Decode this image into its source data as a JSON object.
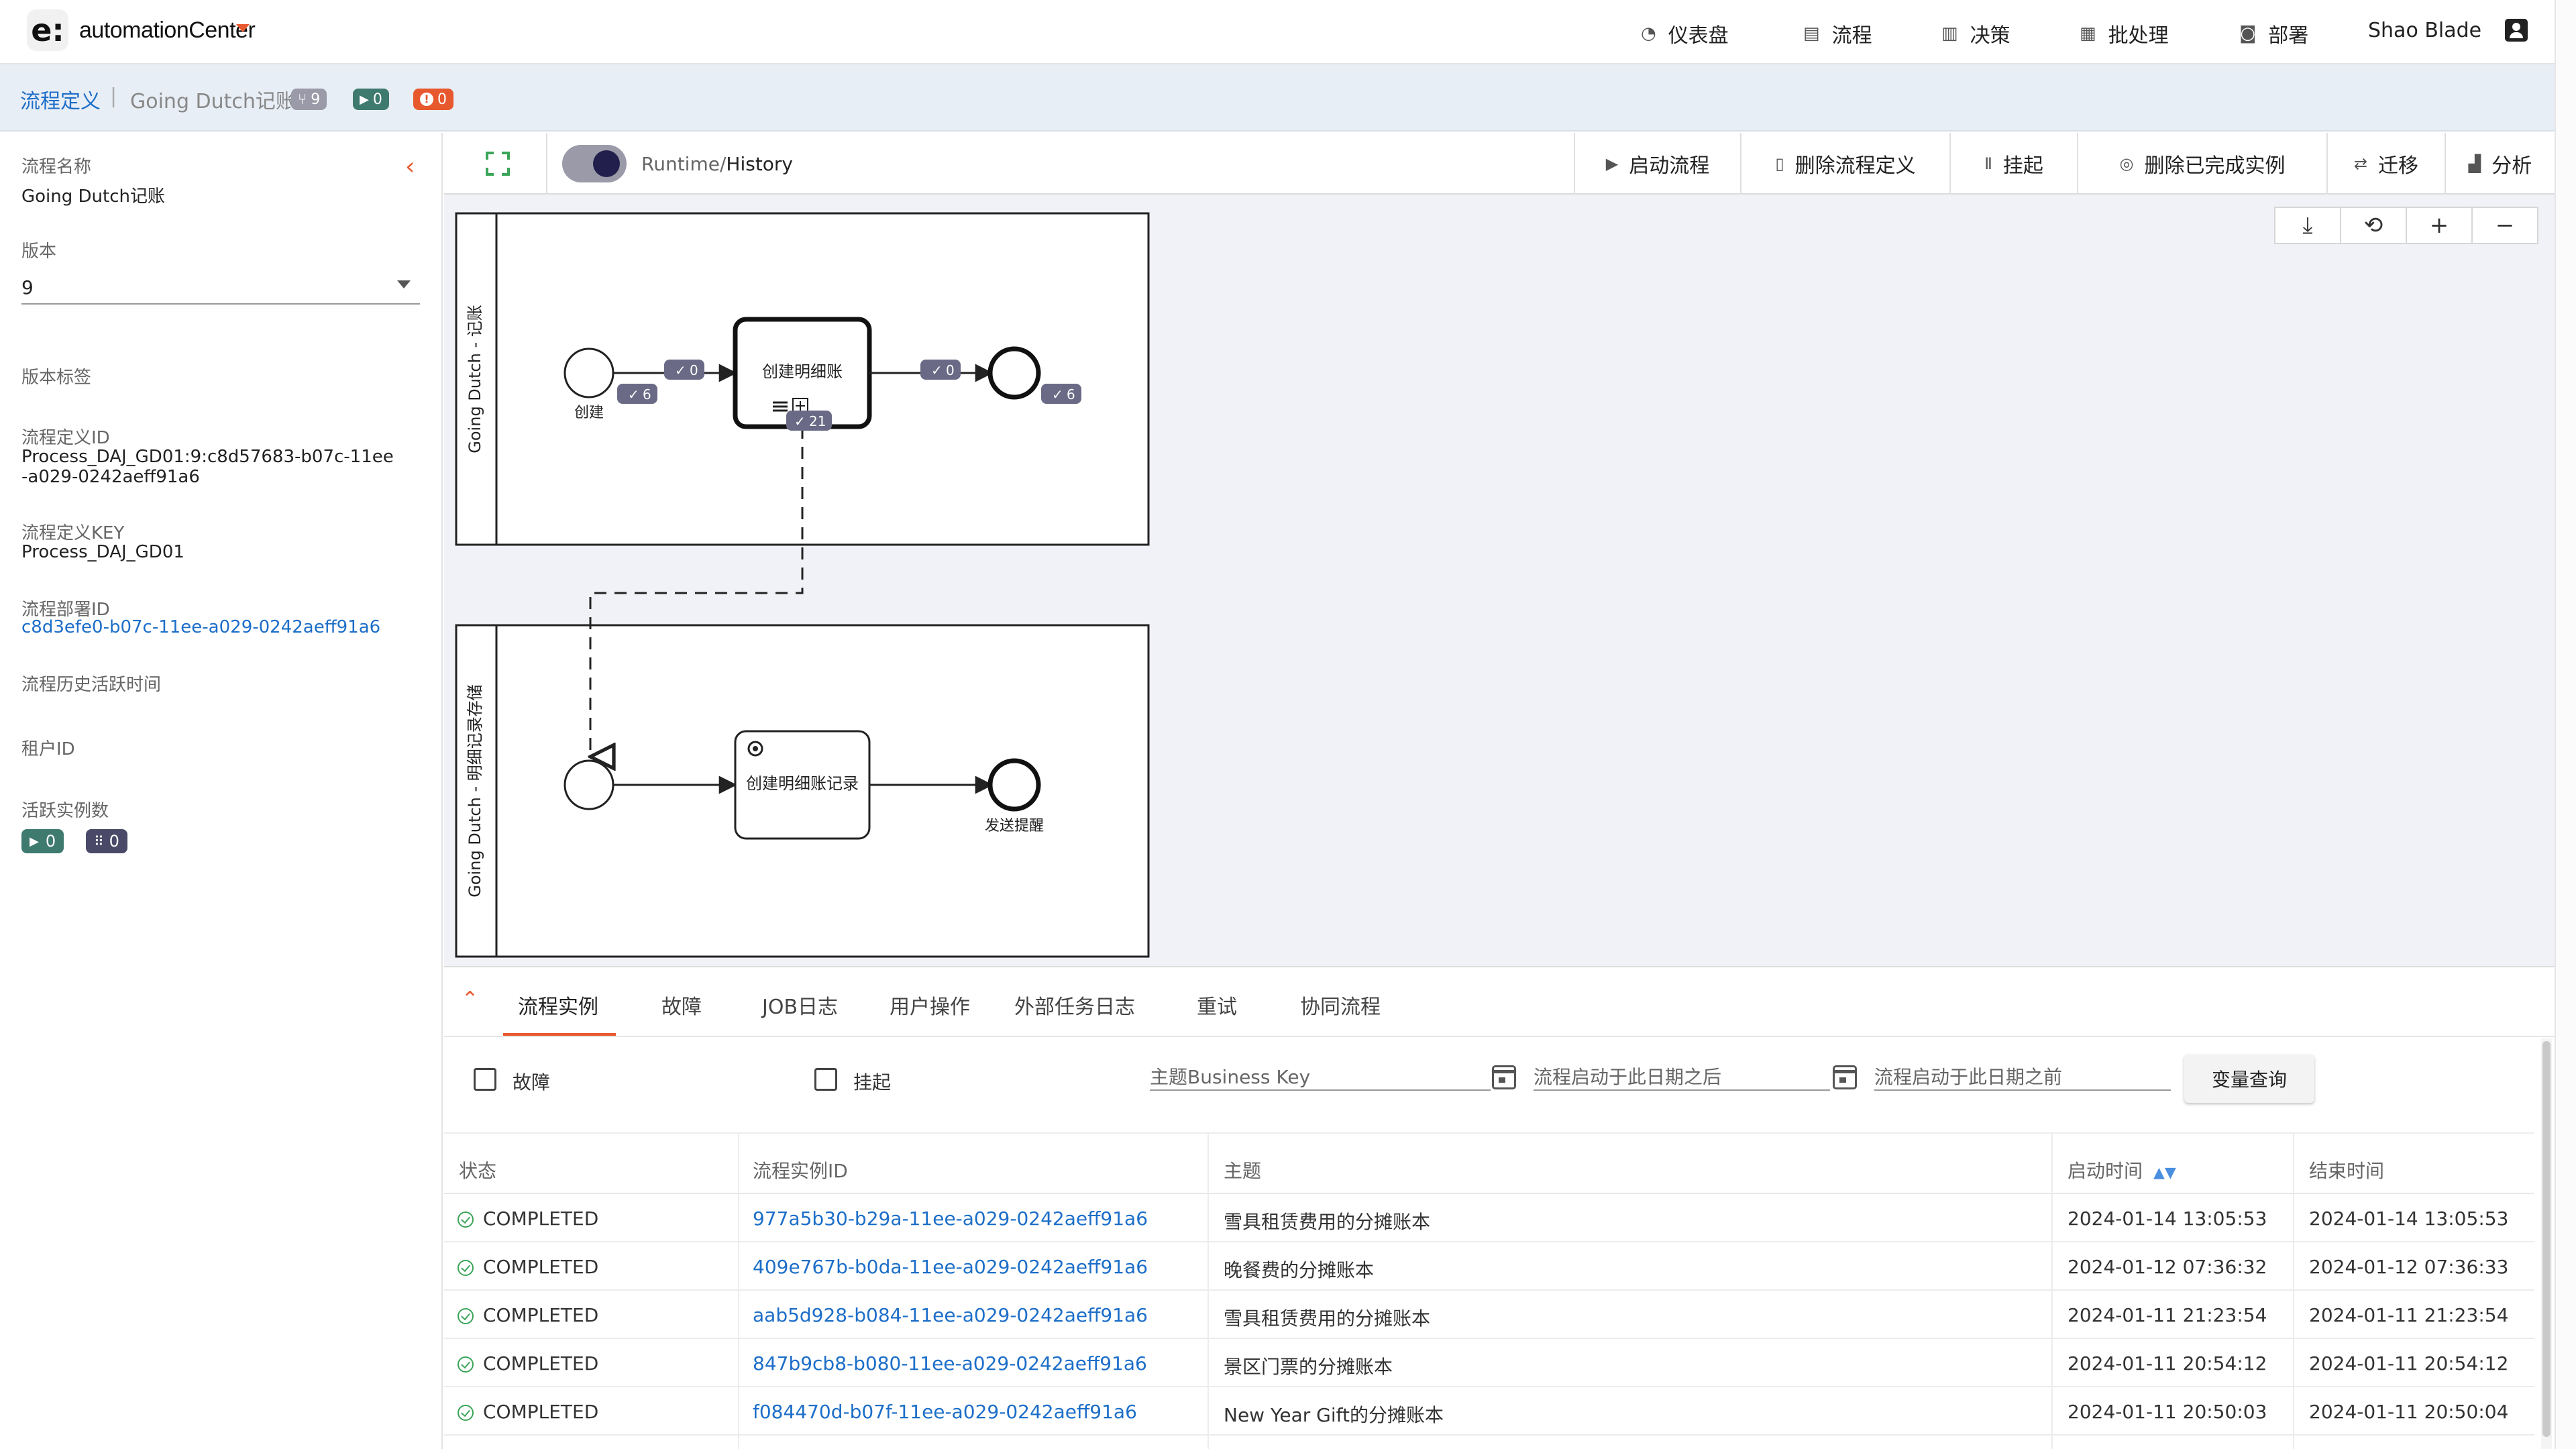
{
  "app": {
    "logo_letter": "e:",
    "name": "automationCenter",
    "nav": [
      {
        "label": "仪表盘",
        "icon": "dashboard-icon",
        "glyph": "◔"
      },
      {
        "label": "流程",
        "icon": "process-icon",
        "glyph": "▤"
      },
      {
        "label": "决策",
        "icon": "decision-icon",
        "glyph": "▥"
      },
      {
        "label": "批处理",
        "icon": "batch-icon",
        "glyph": "▦"
      },
      {
        "label": "部署",
        "icon": "deploy-icon",
        "glyph": "◙"
      }
    ],
    "user": "Shao Blade"
  },
  "breadcrumb": {
    "root": "流程定义",
    "separator": "|",
    "current": "Going Dutch记账",
    "badges": [
      {
        "icon": "branch-icon",
        "glyph": "⑂",
        "value": "9",
        "color": "#9a9aa8"
      },
      {
        "icon": "running-icon",
        "glyph": "▶",
        "value": "0",
        "color": "#3f7a6f"
      },
      {
        "icon": "incident-icon",
        "glyph": "!",
        "value": "0",
        "color": "#e8582e"
      }
    ]
  },
  "details": {
    "name_label": "流程名称",
    "name_value": "Going Dutch记账",
    "version_label": "版本",
    "version_value": "9",
    "version_tag_label": "版本标签",
    "def_id_label": "流程定义ID",
    "def_id_value": "Process_DAJ_GD01:9:c8d57683-b07c-11ee-a029-0242aeff91a6",
    "def_key_label": "流程定义KEY",
    "def_key_value": "Process_DAJ_GD01",
    "deploy_id_label": "流程部署ID",
    "deploy_id_value": "c8d3efe0-b07c-11ee-a029-0242aeff91a6",
    "history_label": "流程历史活跃时间",
    "tenant_label": "租户ID",
    "active_label": "活跃实例数",
    "active_running": "0",
    "active_tokens": "0"
  },
  "toolbar": {
    "toggle_runtime": "Runtime/",
    "toggle_history": "History",
    "buttons": [
      {
        "label": "启动流程",
        "icon": "play-circle-icon",
        "glyph": "▶"
      },
      {
        "label": "删除流程定义",
        "icon": "trash-icon",
        "glyph": "▯"
      },
      {
        "label": "挂起",
        "icon": "pause-icon",
        "glyph": "Ⅱ"
      },
      {
        "label": "删除已完成实例",
        "icon": "delete-finished-icon",
        "glyph": "◎"
      },
      {
        "label": "迁移",
        "icon": "migrate-icon",
        "glyph": "⇄"
      },
      {
        "label": "分析",
        "icon": "chart-icon",
        "glyph": "▟"
      }
    ]
  },
  "diagram": {
    "pool1_name": "Going Dutch - 记账",
    "pool2_name": "Going Dutch - 明细记录存储",
    "start_label": "创建",
    "task1_label": "创建明细账",
    "task2_label": "创建明细账记录",
    "end2_label": "发送提醒",
    "counts": {
      "start_flow": "0",
      "start_done": "6",
      "task_done": "21",
      "end_flow": "0",
      "end_done": "6"
    }
  },
  "canvas_tools": [
    {
      "icon": "download-icon",
      "glyph": "⤓"
    },
    {
      "icon": "reset-zoom-icon",
      "glyph": "⟲"
    },
    {
      "icon": "zoom-in-icon",
      "glyph": "+"
    },
    {
      "icon": "zoom-out-icon",
      "glyph": "−"
    }
  ],
  "tabs": [
    "流程实例",
    "故障",
    "JOB日志",
    "用户操作",
    "外部任务日志",
    "重试",
    "协同流程"
  ],
  "filters": {
    "incident": "故障",
    "suspended": "挂起",
    "business_key_placeholder": "主题Business Key",
    "start_after_placeholder": "流程启动于此日期之后",
    "start_before_placeholder": "流程启动于此日期之前",
    "query_button": "变量查询"
  },
  "table": {
    "headers": [
      "状态",
      "流程实例ID",
      "主题",
      "启动时间",
      "结束时间"
    ],
    "rows": [
      {
        "status": "COMPLETED",
        "id": "977a5b30-b29a-11ee-a029-0242aeff91a6",
        "subject": "雪具租赁费用的分摊账本",
        "start": "2024-01-14 13:05:53",
        "end": "2024-01-14 13:05:53"
      },
      {
        "status": "COMPLETED",
        "id": "409e767b-b0da-11ee-a029-0242aeff91a6",
        "subject": "晚餐费的分摊账本",
        "start": "2024-01-12 07:36:32",
        "end": "2024-01-12 07:36:33"
      },
      {
        "status": "COMPLETED",
        "id": "aab5d928-b084-11ee-a029-0242aeff91a6",
        "subject": "雪具租赁费用的分摊账本",
        "start": "2024-01-11 21:23:54",
        "end": "2024-01-11 21:23:54"
      },
      {
        "status": "COMPLETED",
        "id": "847b9cb8-b080-11ee-a029-0242aeff91a6",
        "subject": "景区门票的分摊账本",
        "start": "2024-01-11 20:54:12",
        "end": "2024-01-11 20:54:12"
      },
      {
        "status": "COMPLETED",
        "id": "f084470d-b07f-11ee-a029-0242aeff91a6",
        "subject": "New Year Gift的分摊账本",
        "start": "2024-01-11 20:50:03",
        "end": "2024-01-11 20:50:04"
      }
    ]
  },
  "colors": {
    "accent": "#e8582e",
    "link": "#1c6ec8",
    "success": "#3aa558",
    "badge_dark": "#4a4a68"
  }
}
